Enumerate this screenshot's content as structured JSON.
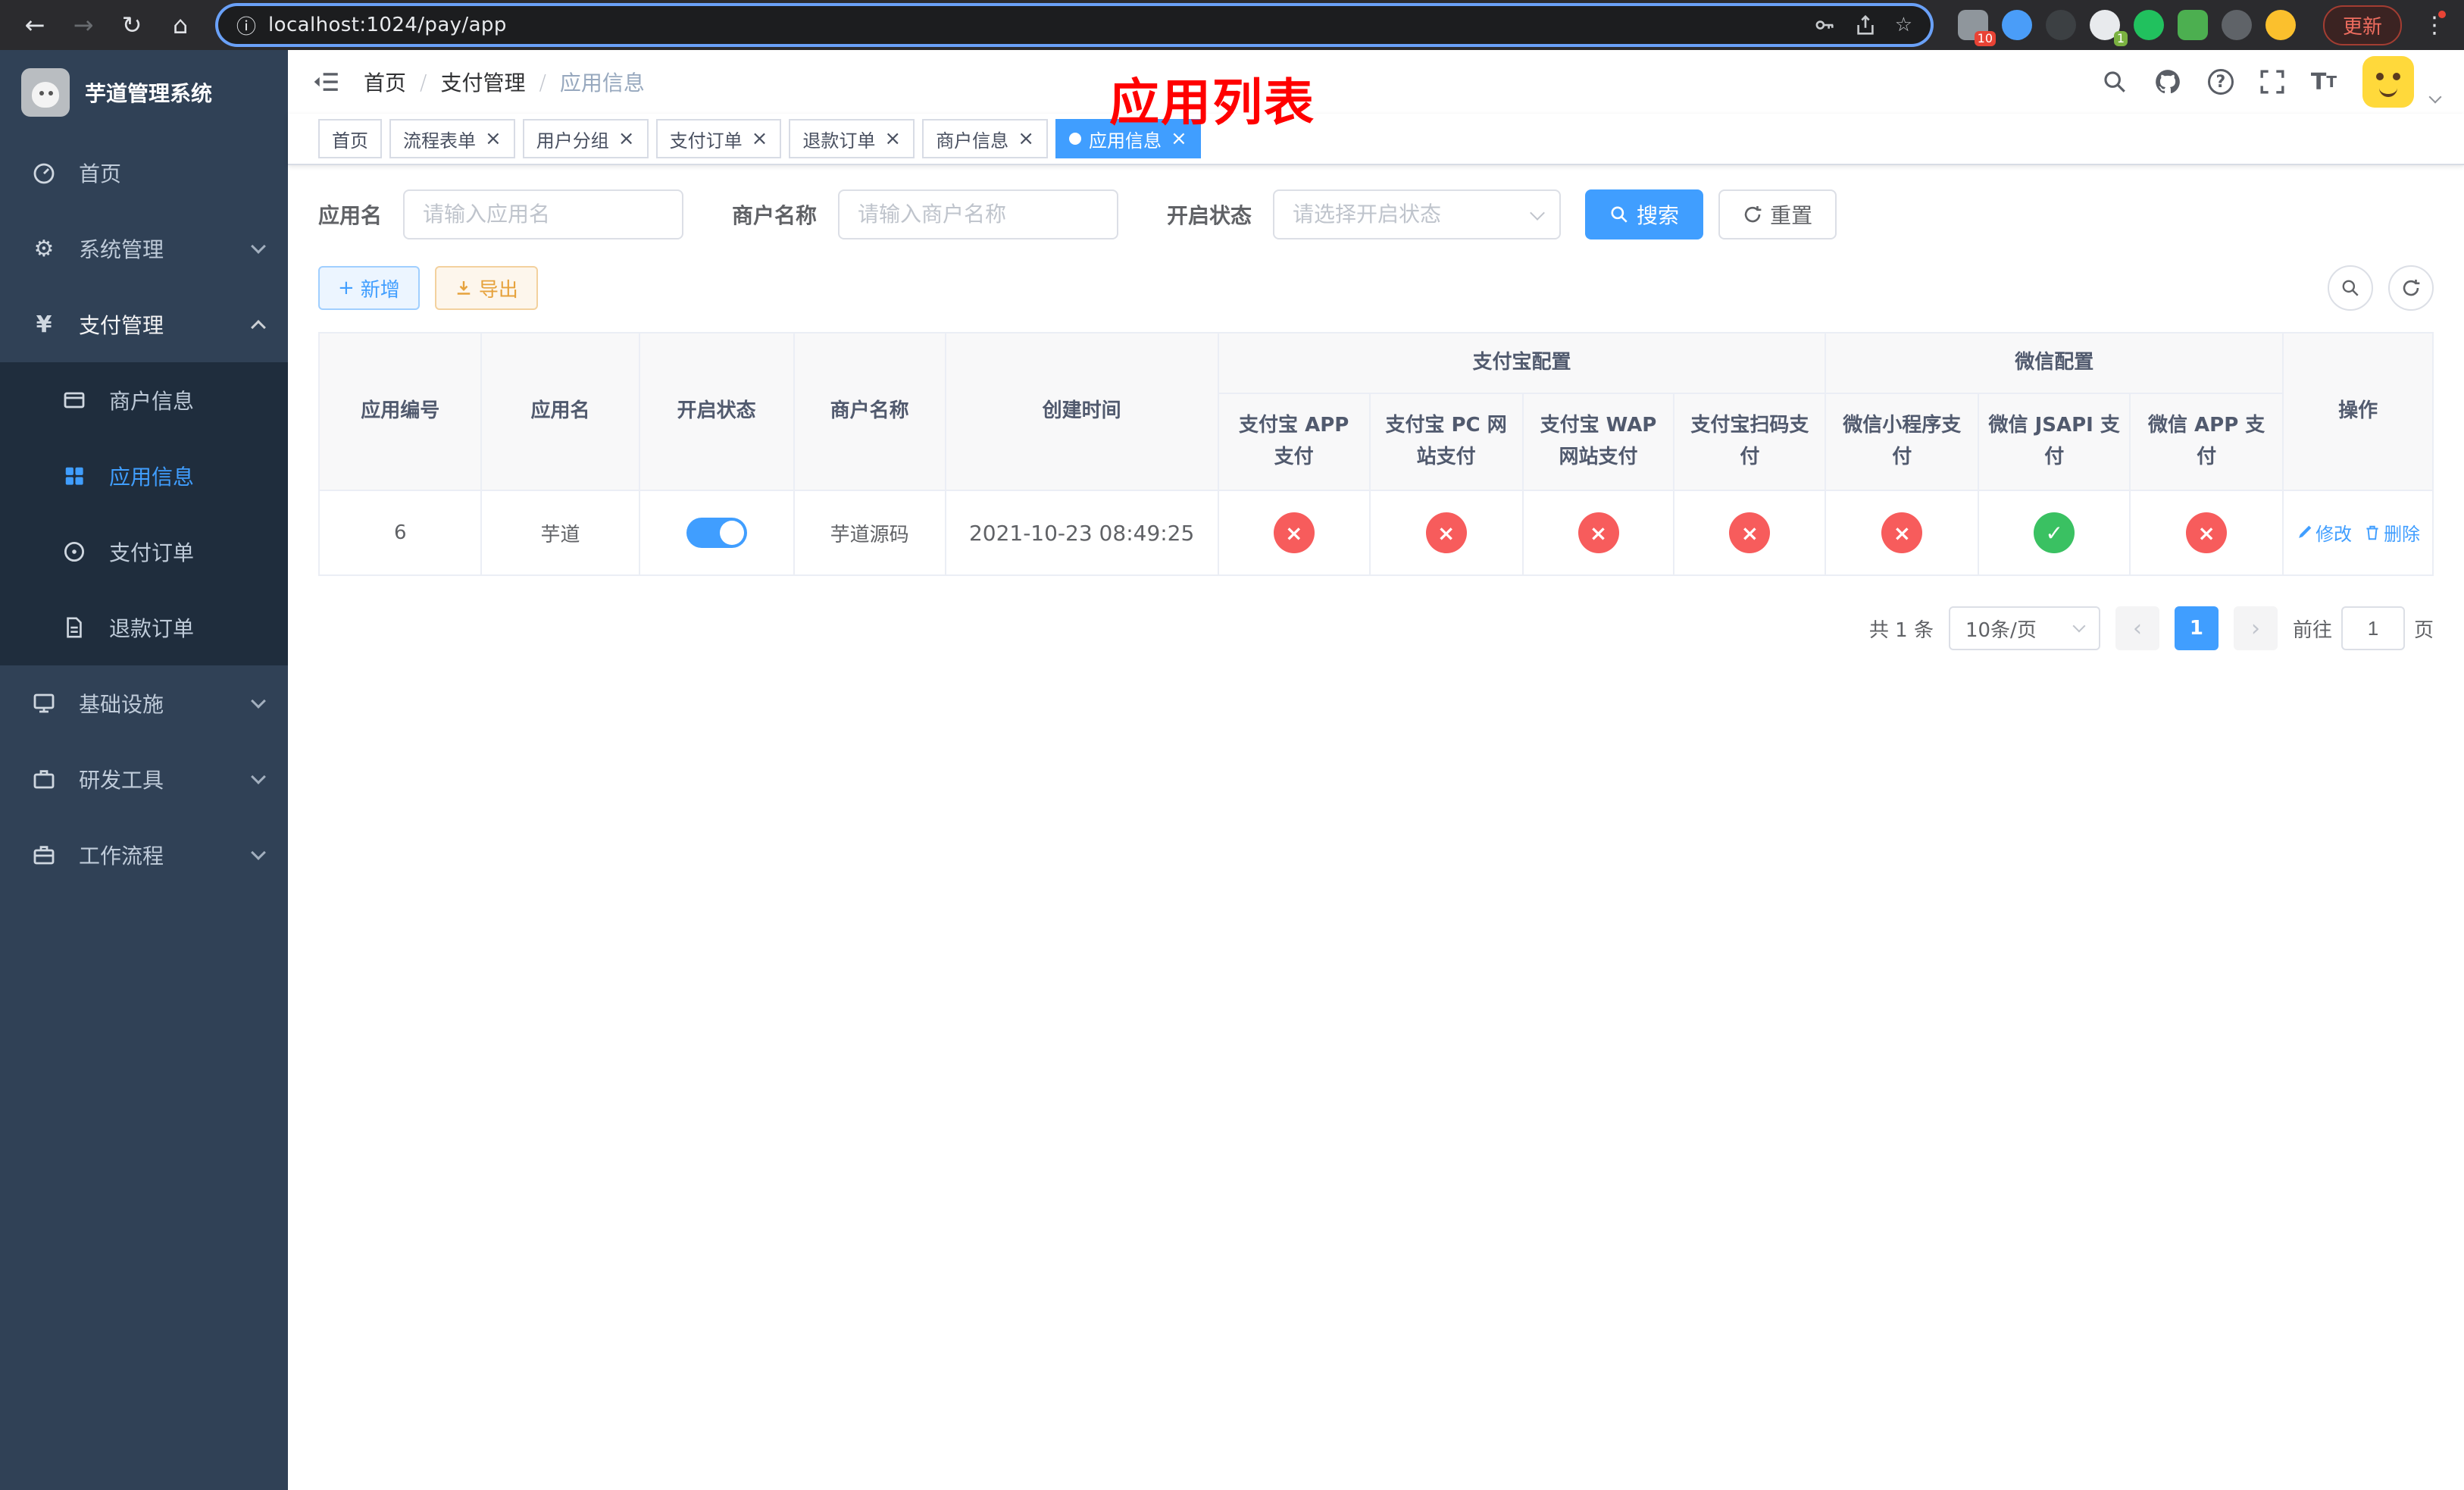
{
  "theme": {
    "primary": "#409eff",
    "success": "#3ac162",
    "danger": "#f75c5c",
    "warning": "#e6a23c",
    "sidebar_bg": "#304156",
    "submenu_bg": "#1f2d3d",
    "annotation_red": "#ff0000"
  },
  "browser": {
    "url": "localhost:1024/pay/app",
    "update_label": "更新",
    "badge_extensions": "10",
    "badge_translate": "1"
  },
  "sidebar": {
    "title": "芋道管理系统",
    "items": [
      {
        "label": "首页"
      },
      {
        "label": "系统管理"
      },
      {
        "label": "支付管理"
      },
      {
        "label": "基础设施"
      },
      {
        "label": "研发工具"
      },
      {
        "label": "工作流程"
      }
    ],
    "payment_children": [
      {
        "label": "商户信息"
      },
      {
        "label": "应用信息",
        "active": true
      },
      {
        "label": "支付订单"
      },
      {
        "label": "退款订单"
      }
    ]
  },
  "header": {
    "breadcrumb": [
      "首页",
      "支付管理",
      "应用信息"
    ],
    "annotation": "应用列表"
  },
  "tabs": [
    {
      "label": "首页",
      "closable": false,
      "active": false
    },
    {
      "label": "流程表单",
      "closable": true,
      "active": false
    },
    {
      "label": "用户分组",
      "closable": true,
      "active": false
    },
    {
      "label": "支付订单",
      "closable": true,
      "active": false
    },
    {
      "label": "退款订单",
      "closable": true,
      "active": false
    },
    {
      "label": "商户信息",
      "closable": true,
      "active": false
    },
    {
      "label": "应用信息",
      "closable": true,
      "active": true
    }
  ],
  "filters": {
    "app_name_label": "应用名",
    "app_name_placeholder": "请输入应用名",
    "merchant_label": "商户名称",
    "merchant_placeholder": "请输入商户名称",
    "status_label": "开启状态",
    "status_placeholder": "请选择开启状态",
    "search_label": "搜索",
    "reset_label": "重置"
  },
  "toolbar": {
    "add_label": "新增",
    "export_label": "导出"
  },
  "table": {
    "group_alipay": "支付宝配置",
    "group_wechat": "微信配置",
    "col_id": "应用编号",
    "col_name": "应用名",
    "col_status": "开启状态",
    "col_merchant": "商户名称",
    "col_created": "创建时间",
    "col_alipay_app": "支付宝 APP 支付",
    "col_alipay_pc": "支付宝 PC 网站支付",
    "col_alipay_wap": "支付宝 WAP 网站支付",
    "col_alipay_qr": "支付宝扫码支付",
    "col_wx_mini": "微信小程序支付",
    "col_wx_jsapi": "微信 JSAPI 支付",
    "col_wx_app": "微信 APP 支付",
    "col_actions": "操作",
    "row": {
      "id": "6",
      "name": "芋道",
      "enabled": true,
      "merchant": "芋道源码",
      "created": "2021-10-23 08:49:25",
      "alipay_app": "closed",
      "alipay_pc": "closed",
      "alipay_wap": "closed",
      "alipay_qr": "closed",
      "wx_mini": "closed",
      "wx_jsapi": "open",
      "wx_app": "closed",
      "edit_label": "修改",
      "delete_label": "删除"
    }
  },
  "pagination": {
    "total_text": "共 1 条",
    "page_size_text": "10条/页",
    "current_page": "1",
    "goto_prefix": "前往",
    "goto_value": "1",
    "goto_suffix": "页"
  }
}
